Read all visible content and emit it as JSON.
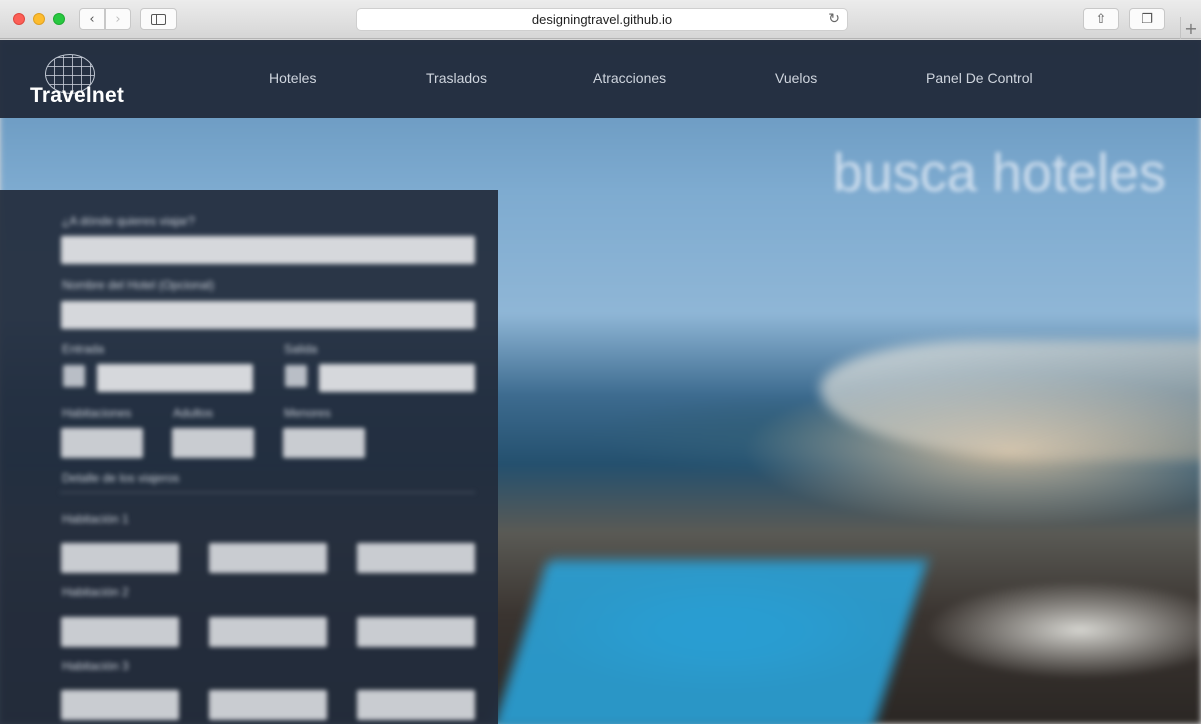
{
  "browser": {
    "url": "designingtravel.github.io",
    "back_glyph": "‹",
    "forward_glyph": "›",
    "reload_glyph": "↻",
    "share_glyph": "⇧",
    "tabs_glyph": "❐",
    "new_tab_glyph": "+"
  },
  "brand": {
    "name": "Travelnet"
  },
  "nav": [
    {
      "label": "Hoteles"
    },
    {
      "label": "Traslados"
    },
    {
      "label": "Atracciones"
    },
    {
      "label": "Vuelos"
    },
    {
      "label": "Panel De Control"
    }
  ],
  "hero": {
    "title": "busca hoteles"
  },
  "search_form": {
    "destination_label": "¿A dónde quieres viajar?",
    "hotel_name_label": "Nombre del Hotel (Opcional)",
    "checkin_label": "Entrada",
    "checkout_label": "Salida",
    "rooms_label": "Habitaciones",
    "adults_label": "Adultos",
    "children_label": "Menores",
    "guests_detail_label": "Detalle de los viajeros",
    "room_labels": [
      "Habitación 1",
      "Habitación 2",
      "Habitación 3"
    ]
  },
  "colors": {
    "nav_bg": "#222c3c",
    "nav_text": "#cfd5de",
    "hero_title": "#ebf0f8"
  }
}
